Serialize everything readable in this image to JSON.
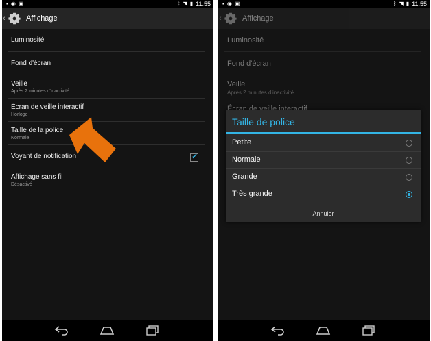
{
  "status": {
    "time": "11:55"
  },
  "left": {
    "title": "Affichage",
    "items": [
      {
        "title": "Luminosité"
      },
      {
        "title": "Fond d'écran"
      },
      {
        "title": "Veille",
        "sub": "Après 2 minutes d'inactivité"
      },
      {
        "title": "Écran de veille interactif",
        "sub": "Horloge"
      },
      {
        "title": "Taille de la police",
        "sub": "Normale"
      },
      {
        "title": "Voyant de notification",
        "checked": true
      },
      {
        "title": "Affichage sans fil",
        "sub": "Désactivé"
      }
    ]
  },
  "right": {
    "title": "Affichage",
    "items": [
      {
        "title": "Luminosité"
      },
      {
        "title": "Fond d'écran"
      },
      {
        "title": "Veille",
        "sub": "Après 2 minutes d'inactivité"
      },
      {
        "title": "Écran de veille interactif"
      }
    ],
    "dialog": {
      "title": "Taille de police",
      "options": [
        {
          "label": "Petite",
          "selected": false
        },
        {
          "label": "Normale",
          "selected": false
        },
        {
          "label": "Grande",
          "selected": false
        },
        {
          "label": "Très grande",
          "selected": true
        }
      ],
      "cancel": "Annuler"
    }
  },
  "accent": "#33b5e5",
  "arrow_color": "#e8720c"
}
